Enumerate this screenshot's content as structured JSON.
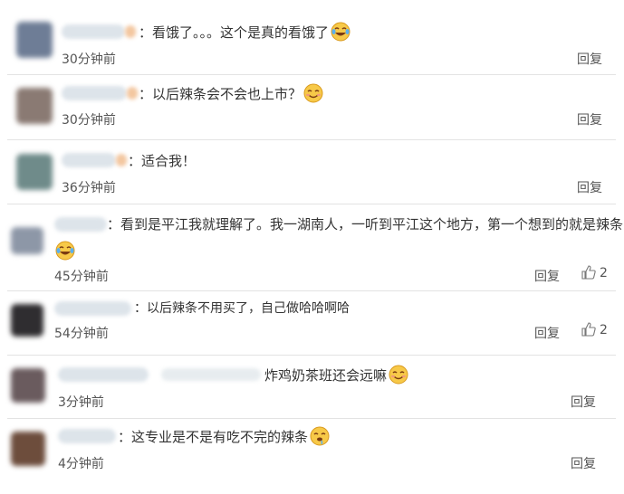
{
  "comments": [
    {
      "text": "：看饿了。。。这个是真的看饿了",
      "time": "30分钟前",
      "reply": "回复",
      "likes": "",
      "emoji": "laugh-cry",
      "avatar_color": "#6e7d96"
    },
    {
      "text": "：以后辣条会不会也上市？",
      "time": "30分钟前",
      "reply": "回复",
      "likes": "",
      "emoji": "smile",
      "avatar_color": "#8a7a73"
    },
    {
      "text": "：适合我！",
      "time": "36分钟前",
      "reply": "回复",
      "likes": "",
      "emoji": "",
      "avatar_color": "#6f8b8a"
    },
    {
      "text": "：看到是平江我就理解了。我一湖南人，一听到平江这个地方，第一个想到的就是辣条",
      "time": "45分钟前",
      "reply": "回复",
      "likes": "2",
      "emoji": "laugh-cry",
      "avatar_color": "#8d97a7"
    },
    {
      "text": "：以后辣条不用买了，自己做哈哈啊哈",
      "time": "54分钟前",
      "reply": "回复",
      "likes": "2",
      "emoji": "",
      "avatar_color": "#2f2d30"
    },
    {
      "text": "炸鸡奶茶班还会远嘛",
      "time": "3分钟前",
      "reply": "回复",
      "likes": "",
      "emoji": "smile",
      "avatar_color": "#6a5b5e"
    },
    {
      "text": "：这专业是不是有吃不完的辣条",
      "time": "4分钟前",
      "reply": "回复",
      "likes": "",
      "emoji": "drool",
      "avatar_color": "#6d4d3c"
    }
  ]
}
